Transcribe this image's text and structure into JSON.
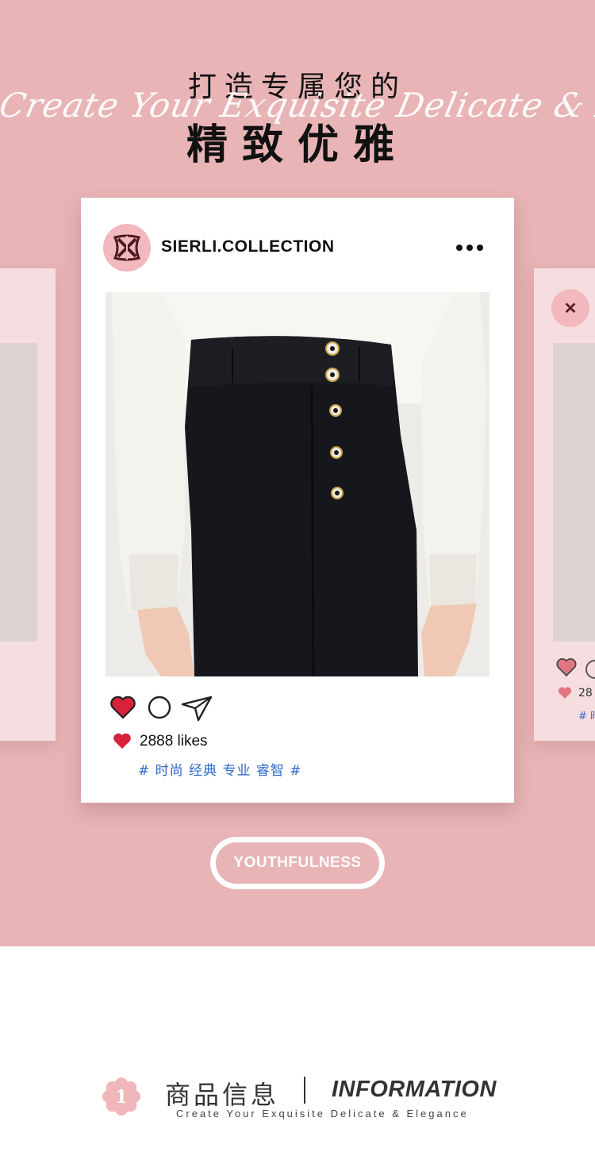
{
  "hero": {
    "headline_line1": "打造专属您的",
    "script_tagline": "Create Your Exquisite Delicate & Elegance",
    "headline_line2": "精致优雅",
    "background_color": "#e8b4b6"
  },
  "post": {
    "account_handle": "SIERLI.COLLECTION",
    "likes_text": "2888 likes",
    "hashtags": "# 时尚 经典 专业 睿智 #",
    "icons": [
      "logo-icon",
      "more-options-icon",
      "heart-icon",
      "comment-icon",
      "send-icon"
    ]
  },
  "side_card_right": {
    "likes_partial": "28",
    "tag_partial": "# 时"
  },
  "badge": {
    "label": "YOUTHFULNESS"
  },
  "section": {
    "number": "1",
    "title_cn": "商品信息",
    "title_en": "INFORMATION",
    "subtitle": "Create Your Exquisite Delicate & Elegance"
  },
  "colors": {
    "pink": "#e8b4b6",
    "heart_red": "#d7223a",
    "hashtag_blue": "#2e6ac7"
  }
}
